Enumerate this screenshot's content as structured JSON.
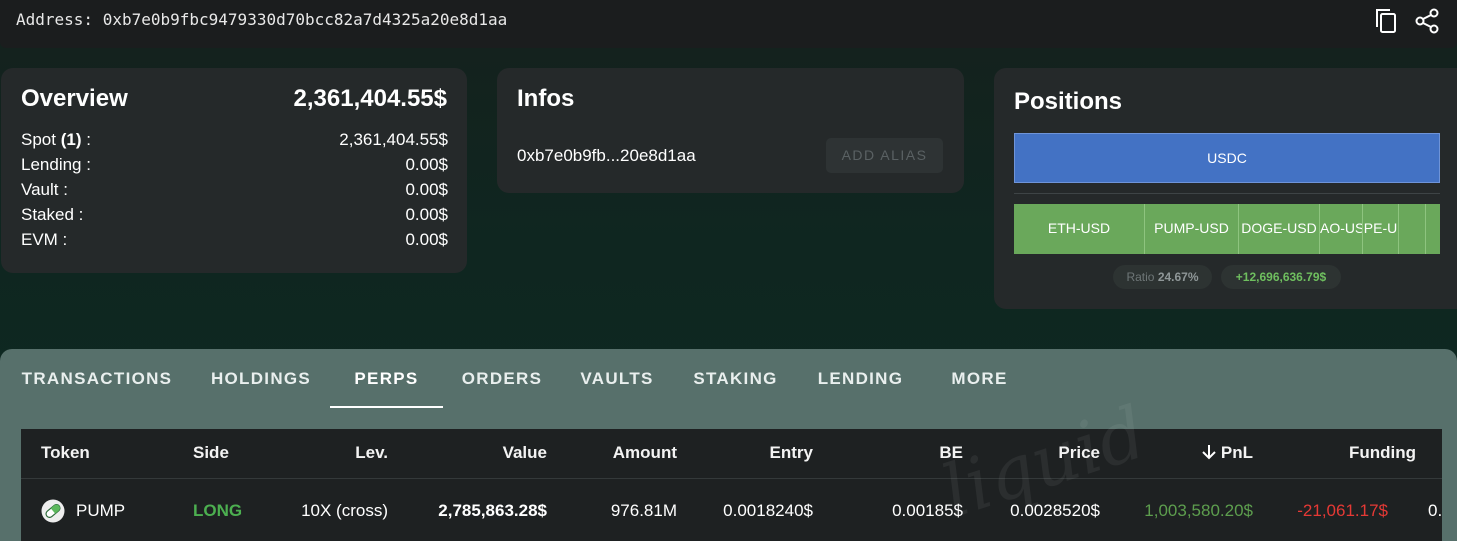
{
  "header": {
    "address_label": "Address: 0xb7e0b9fbc9479330d70bcc82a7d4325a20e8d1aa",
    "copy_icon": "copy-icon",
    "share_icon": "share-icon"
  },
  "overview": {
    "title": "Overview",
    "total": "2,361,404.55$",
    "rows": [
      {
        "label_prefix": "Spot ",
        "label_bold": "(1)",
        "label_suffix": " :",
        "value": "2,361,404.55$"
      },
      {
        "label": "Lending :",
        "value": "0.00$"
      },
      {
        "label": "Vault :",
        "value": "0.00$"
      },
      {
        "label": "Staked :",
        "value": "0.00$"
      },
      {
        "label": "EVM :",
        "value": "0.00$"
      }
    ]
  },
  "infos": {
    "title": "Infos",
    "short_address": "0xb7e0b9fb...20e8d1aa",
    "add_alias_label": "ADD ALIAS"
  },
  "positions": {
    "title": "Positions",
    "usdc_label": "USDC",
    "segments": [
      "ETH-USD",
      "PUMP-USD",
      "DOGE-USD",
      "AO-US",
      "PE-U",
      "",
      ""
    ],
    "ratio_label": "Ratio",
    "ratio_value": "24.67%",
    "pnl_value": "+12,696,636.79$",
    "colors": {
      "usdc": "#4372c4",
      "perps": "#6aa85b",
      "positive": "#6fbf5f"
    }
  },
  "tabs": {
    "items": [
      "TRANSACTIONS",
      "HOLDINGS",
      "PERPS",
      "ORDERS",
      "VAULTS",
      "STAKING",
      "LENDING",
      "MORE"
    ],
    "active": "PERPS"
  },
  "table": {
    "headers": [
      "Token",
      "Side",
      "Lev.",
      "Value",
      "Amount",
      "Entry",
      "BE",
      "Price",
      "PnL",
      "Funding"
    ],
    "sort_icon": "arrow-down-icon",
    "row": {
      "token": "PUMP",
      "token_icon": "pill-icon",
      "side": "LONG",
      "lev": "10X (cross)",
      "value": "2,785,863.28$",
      "amount": "976.81M",
      "entry": "0.0018240$",
      "be": "0.00185$",
      "price": "0.0028520$",
      "pnl": "1,003,580.20$",
      "funding": "-21,061.17$",
      "overflow": "0."
    },
    "colors": {
      "long": "#4caf50",
      "pnl_positive": "#5d9e4e",
      "funding_negative": "#e53935"
    }
  },
  "watermark": "liquid"
}
